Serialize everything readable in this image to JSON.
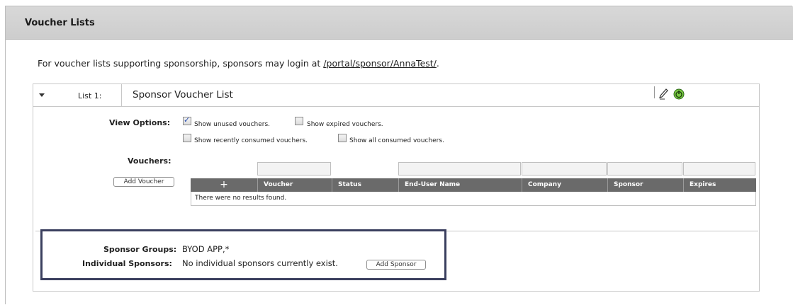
{
  "page": {
    "title": "Voucher Lists"
  },
  "intro": {
    "text": "For voucher lists supporting sponsorship, sponsors may login at ",
    "link": "/portal/sponsor/AnnaTest/",
    "suffix": "."
  },
  "list": {
    "number_label": "List 1:",
    "name": "Sponsor Voucher List",
    "view_options_label": "View Options:",
    "options": [
      {
        "label": "Show unused vouchers.",
        "checked": true
      },
      {
        "label": "Show expired vouchers.",
        "checked": false
      },
      {
        "label": "Show recently consumed vouchers.",
        "checked": false
      },
      {
        "label": "Show all consumed vouchers.",
        "checked": false
      }
    ],
    "vouchers_label": "Vouchers:",
    "add_voucher_button": "Add Voucher",
    "table": {
      "add_col": "+",
      "columns": [
        "Voucher",
        "Status",
        "End-User Name",
        "Company",
        "Sponsor",
        "Expires"
      ],
      "empty_message": "There were no results found."
    }
  },
  "sponsors": {
    "groups_label": "Sponsor Groups:",
    "groups_value": "BYOD APP,*",
    "individual_label": "Individual Sponsors:",
    "individual_value": "No individual sponsors currently exist.",
    "add_sponsor_button": "Add Sponsor"
  }
}
